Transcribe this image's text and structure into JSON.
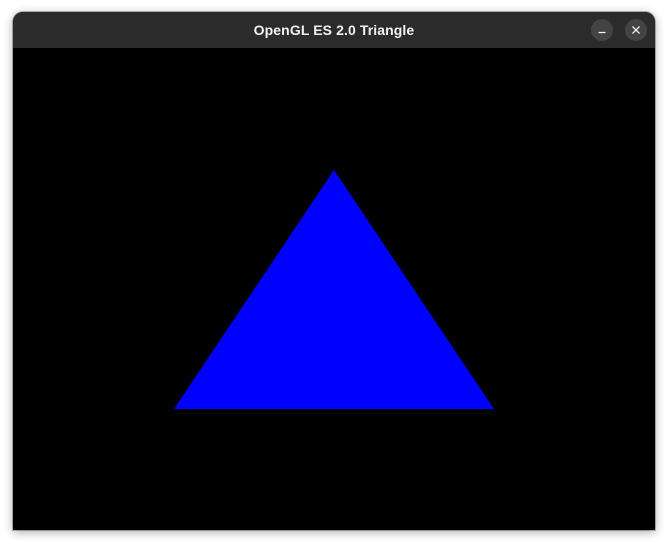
{
  "window": {
    "title": "OpenGL ES 2.0 Triangle"
  },
  "controls": {
    "minimize_icon": "minimize-icon",
    "close_icon": "close-icon"
  },
  "scene": {
    "background_color": "#000000",
    "triangle_color": "#0000ff"
  }
}
